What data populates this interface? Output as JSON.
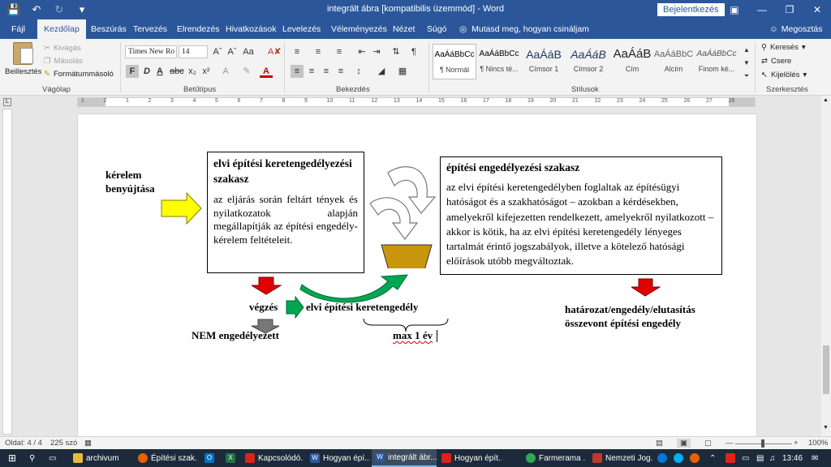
{
  "titlebar": {
    "title": "integrált ábra [kompatibilis üzemmód] - Word",
    "signin": "Bejelentkezés"
  },
  "tabs": [
    "Fájl",
    "Kezdőlap",
    "Beszúrás",
    "Tervezés",
    "Elrendezés",
    "Hivatkozások",
    "Levelezés",
    "Véleményezés",
    "Nézet",
    "Súgó"
  ],
  "tell_me": "Mutasd meg, hogyan csináljam",
  "share": "Megosztás",
  "ribbon": {
    "clipboard": {
      "paste": "Beillesztés",
      "cut": "Kivágás",
      "copy": "Másolás",
      "format_painter": "Formátummásoló",
      "group": "Vágólap"
    },
    "font": {
      "name": "Times New Ro",
      "size": "14",
      "group": "Betűtípus"
    },
    "paragraph": {
      "group": "Bekezdés"
    },
    "styles": {
      "group": "Stílusok",
      "items": [
        {
          "sample": "AaÁáBbCc",
          "name": "¶ Normál"
        },
        {
          "sample": "AaÁáBbCc",
          "name": "¶ Nincs té..."
        },
        {
          "sample": "AaÁáB",
          "name": "Címsor 1"
        },
        {
          "sample": "AaÁáB",
          "name": "Címsor 2"
        },
        {
          "sample": "AaÁáB",
          "name": "Cím"
        },
        {
          "sample": "AaÁáBbC",
          "name": "Alcím"
        },
        {
          "sample": "AaÁáBbCc",
          "name": "Finom ké..."
        }
      ]
    },
    "editing": {
      "find": "Keresés",
      "replace": "Csere",
      "select": "Kijelölés",
      "group": "Szerkesztés"
    }
  },
  "ruler": {
    "ticks": [
      "1",
      "2",
      "1",
      "2",
      "3",
      "4",
      "5",
      "6",
      "7",
      "8",
      "9",
      "10",
      "11",
      "12",
      "13",
      "14",
      "15",
      "16",
      "17",
      "18",
      "19",
      "20",
      "21",
      "22",
      "23",
      "24",
      "25",
      "26",
      "27",
      "28"
    ]
  },
  "document": {
    "request": "kérelem benyújtása",
    "box1_title": "elvi építési keretengedélyezési szakasz",
    "box1_body": "az eljárás során feltárt tények és nyilatkozatok alapján megállapítják az építési engedély-kérelem feltételeit.",
    "box2_title": "építési engedélyezési szakasz",
    "box2_body": "az elvi építési keretengedélyben foglaltak az építésügyi hatóságot és a szakhatóságot – azokban a kérdésekben, amelyekről kifejezetten rendelkezett, amelyekről nyilatkozott – akkor is kötik, ha az elvi építési keretengedély lényeges tartalmát érintő jogszabályok, illetve a kötelező hatósági előírások utóbb megváltoztak.",
    "vegzes": "végzés",
    "keret": "elvi építési keretengedély",
    "nem": "NEM engedélyezett",
    "max": "max 1 év",
    "hatarozat_line1": "határozat/engedély/elutasítás",
    "hatarozat_line2": "összevont építési engedély"
  },
  "status": {
    "page": "Oldal: 4 / 4",
    "words": "225 szó",
    "zoom": "100%"
  },
  "taskbar": {
    "items": [
      "archivum",
      "Építési szak...",
      "",
      "",
      "Kapcsolódó...",
      "Hogyan épí...",
      "integrált ábr...",
      "Hogyan épít...",
      "Farmerama ...",
      "Nemzeti Jog..."
    ],
    "time": "13:46"
  },
  "colors": {
    "word_blue": "#2b579a",
    "arrow_yellow": "#ffff00",
    "arrow_red": "#ff0000",
    "arrow_green": "#00a651",
    "funnel": "#c8960c"
  }
}
